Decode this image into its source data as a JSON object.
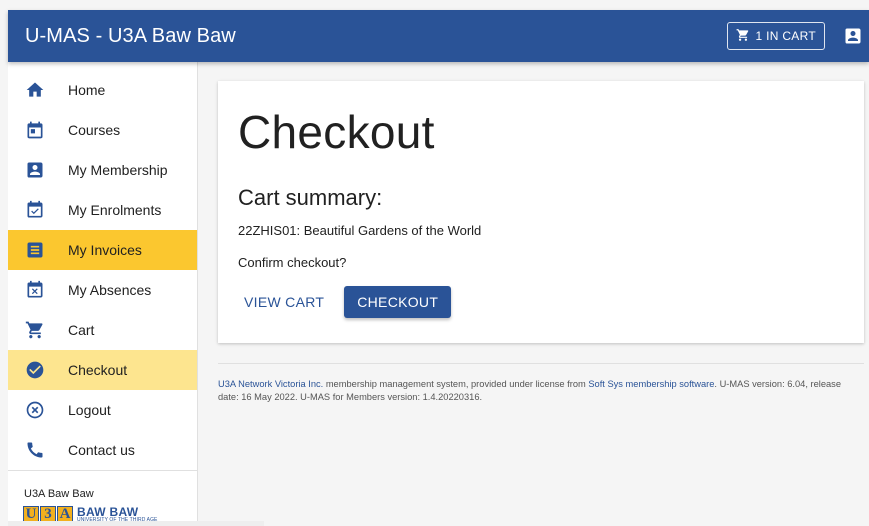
{
  "header": {
    "title": "U-MAS - U3A Baw Baw",
    "cart_label": "1 IN CART"
  },
  "sidebar": {
    "items": [
      {
        "label": "Home",
        "icon": "home-icon"
      },
      {
        "label": "Courses",
        "icon": "calendar-icon"
      },
      {
        "label": "My Membership",
        "icon": "account-box-icon"
      },
      {
        "label": "My Enrolments",
        "icon": "event-check-icon"
      },
      {
        "label": "My Invoices",
        "icon": "receipt-list-icon"
      },
      {
        "label": "My Absences",
        "icon": "event-busy-icon"
      },
      {
        "label": "Cart",
        "icon": "cart-icon"
      },
      {
        "label": "Checkout",
        "icon": "check-circle-icon"
      },
      {
        "label": "Logout",
        "icon": "cancel-circle-icon"
      },
      {
        "label": "Contact us",
        "icon": "phone-icon"
      }
    ],
    "org_name": "U3A Baw Baw",
    "logo": {
      "letters": [
        "U",
        "3",
        "A"
      ],
      "line1": "BAW BAW",
      "line2": "UNIVERSITY OF THE THIRD AGE"
    }
  },
  "main": {
    "heading": "Checkout",
    "subheading": "Cart summary:",
    "cart_item": "22ZHIS01: Beautiful Gardens of the World",
    "confirm_text": "Confirm checkout?",
    "view_cart_label": "VIEW CART",
    "checkout_label": "CHECKOUT"
  },
  "footer": {
    "link1": "U3A Network Victoria Inc.",
    "text1": " membership management system, provided under license from ",
    "link2": "Soft Sys membership software",
    "text2": ". U-MAS version: 6.04, release date: 16 May 2022. U-MAS for Members version: 1.4.20220316."
  },
  "colors": {
    "primary": "#2a5397",
    "active_invoices": "#fbc72f",
    "active_checkout": "#fde58f"
  }
}
